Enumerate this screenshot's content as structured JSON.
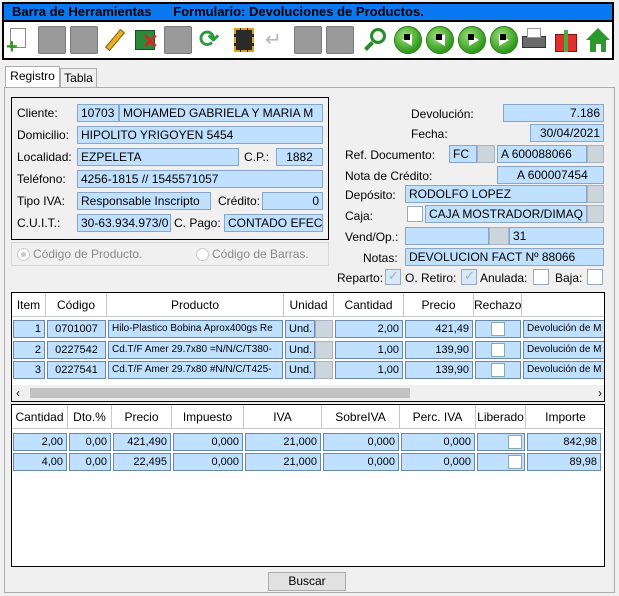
{
  "title": {
    "left": "Barra de Herramientas",
    "right": "Formulario: Devoluciones de Productos."
  },
  "toolbar": {
    "icons": [
      "new-icon",
      "save-disabled-icon",
      "save-disabled-icon",
      "edit-icon",
      "delete-icon",
      "undo-disabled-icon",
      "refresh-icon",
      "film-icon",
      "back-disabled-icon",
      "disabled-icon",
      "disabled-icon",
      "search-icon",
      "first-icon",
      "prev-icon",
      "next-icon",
      "last-icon",
      "print-icon",
      "gift-icon",
      "home-icon"
    ]
  },
  "tabs": [
    "Registro",
    "Tabla"
  ],
  "cliente": {
    "label_cliente": "Cliente:",
    "codigo": "10703",
    "nombre": "MOHAMED GABRIELA Y MARIA M",
    "label_domicilio": "Domicilio:",
    "domicilio": "HIPOLITO YRIGOYEN 5454",
    "label_localidad": "Localidad:",
    "localidad": "EZPELETA",
    "label_cp": "C.P.:",
    "cp": "1882",
    "label_telefono": "Teléfono:",
    "telefono": "4256-1815 // 1545571057",
    "label_tipo_iva": "Tipo IVA:",
    "tipo_iva": "Responsable Inscripto",
    "label_credito": "Crédito:",
    "credito": "0",
    "label_cuit": "C.U.I.T.:",
    "cuit": "30-63.934.973/0",
    "label_cpago": "C. Pago:",
    "cpago": "CONTADO EFEC"
  },
  "devolucion": {
    "label_devolucion": "Devolución:",
    "devolucion": "7.186",
    "label_fecha": "Fecha:",
    "fecha": "30/04/2021",
    "label_ref": "Ref. Documento:",
    "ref_tipo": "FC",
    "ref_letra": "A",
    "ref_num": "600088066",
    "label_nota": "Nota de Crédito:",
    "nota_letra": "A",
    "nota_num": "600007454",
    "label_deposito": "Depósito:",
    "deposito": "RODOLFO LOPEZ",
    "label_caja": "Caja:",
    "caja": "CAJA MOSTRADOR/DIMAQ",
    "label_vend": "Vend/Op.:",
    "vend": "31",
    "label_notas": "Notas:",
    "notas": "DEVOLUCION FACT Nº 88066",
    "label_reparto": "Reparto:",
    "label_oretiro": "O. Retiro:",
    "label_anulada": "Anulada:",
    "label_baja": "Baja:"
  },
  "radios": {
    "codigo_producto": "Código de Producto.",
    "codigo_barras": "Código de Barras."
  },
  "grid1": {
    "headers": [
      "Item",
      "Código",
      "Producto",
      "Unidad",
      "Cantidad",
      "Precio",
      "Rechazo",
      ""
    ],
    "rows": [
      {
        "item": "1",
        "codigo": "0701007",
        "producto": "Hilo-Plastico Bobina Aprox400gs Re",
        "unidad": "Und.",
        "cantidad": "2,00",
        "precio": "421,49",
        "motivo": "Devolución de M"
      },
      {
        "item": "2",
        "codigo": "0227542",
        "producto": "Cd.T/F Amer 29.7x80 =N/N/C/T380-",
        "unidad": "Und.",
        "cantidad": "1,00",
        "precio": "139,90",
        "motivo": "Devolución de M"
      },
      {
        "item": "3",
        "codigo": "0227541",
        "producto": "Cd.T/F Amer 29.7x80 #N/N/C/T425-",
        "unidad": "Und.",
        "cantidad": "1,00",
        "precio": "139,90",
        "motivo": "Devolución de M"
      }
    ]
  },
  "grid2": {
    "headers": [
      "Cantidad",
      "Dto.%",
      "Precio",
      "Impuesto",
      "IVA",
      "SobreIVA",
      "Perc. IVA",
      "Liberado",
      "Importe"
    ],
    "rows": [
      {
        "cantidad": "2,00",
        "dto": "0,00",
        "precio": "421,490",
        "impuesto": "0,000",
        "iva": "21,000",
        "sobreiva": "0,000",
        "perc": "0,000",
        "importe": "842,98"
      },
      {
        "cantidad": "4,00",
        "dto": "0,00",
        "precio": "22,495",
        "impuesto": "0,000",
        "iva": "21,000",
        "sobreiva": "0,000",
        "perc": "0,000",
        "importe": "89,98"
      }
    ]
  },
  "buscar": "Buscar"
}
